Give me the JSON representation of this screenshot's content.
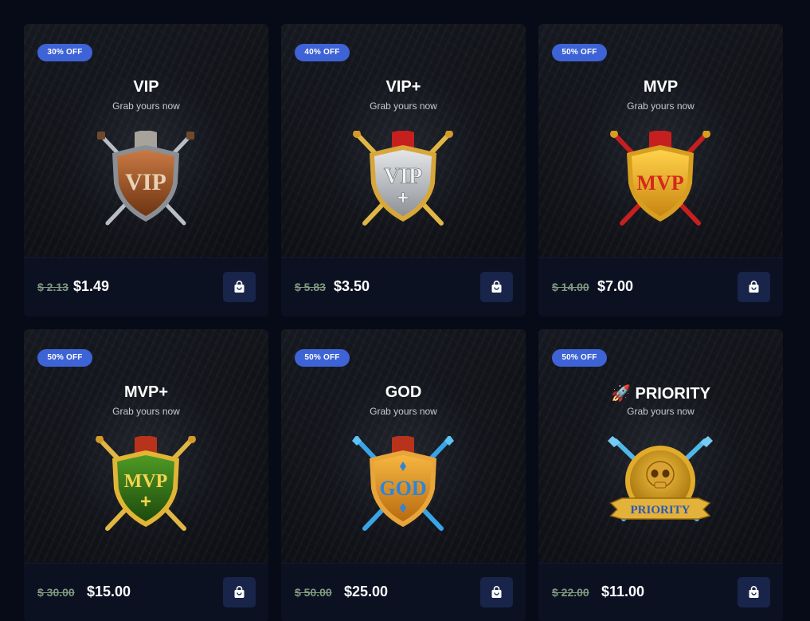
{
  "products": [
    {
      "badge": "30% OFF",
      "title": "VIP",
      "subtitle": "Grab yours now",
      "old_price": "$ 2.13",
      "new_price": "$1.49",
      "emblem_text": "VIP",
      "emblem_icon": "vip-shield-emblem-icon",
      "colors": {
        "shield_light": "#c97a44",
        "shield_dark": "#6e3412",
        "rim": "#8a8f96",
        "ribbon": "#a7a39b",
        "blade": "#b9bec6",
        "letters": "#e7d2b5"
      }
    },
    {
      "badge": "40% OFF",
      "title": "VIP+",
      "subtitle": "Grab yours now",
      "old_price": "$ 5.83",
      "new_price": "$3.50",
      "emblem_text": "VIP",
      "emblem_plus": "+",
      "emblem_icon": "vip-plus-shield-emblem-icon",
      "colors": {
        "shield_light": "#e4e6e8",
        "shield_dark": "#8d9196",
        "rim": "#d7a73a",
        "ribbon": "#c61f1f",
        "blade": "#e0b645",
        "letters": "#f3f3f3"
      }
    },
    {
      "badge": "50% OFF",
      "title": "MVP",
      "subtitle": "Grab yours now",
      "old_price": "$ 14.00",
      "new_price": "$7.00",
      "emblem_text": "MVP",
      "emblem_icon": "mvp-shield-emblem-icon",
      "colors": {
        "shield_light": "#ffd24a",
        "shield_dark": "#c98612",
        "rim": "#d79e20",
        "ribbon": "#c61f1f",
        "blade": "#c71f1f",
        "letters": "#d5281d"
      }
    },
    {
      "badge": "50% OFF",
      "title": "MVP+",
      "subtitle": "Grab yours now",
      "old_price": "$ 30.00",
      "new_price": "$15.00",
      "emblem_text": "MVP",
      "emblem_plus": "+",
      "emblem_icon": "mvp-plus-shield-emblem-icon",
      "colors": {
        "shield_light": "#4f9a24",
        "shield_dark": "#1d4a0d",
        "rim": "#e2b535",
        "ribbon": "#b8331b",
        "blade": "#e0b645",
        "letters": "#f6d34f"
      }
    },
    {
      "badge": "50% OFF",
      "title": "GOD",
      "subtitle": "Grab yours now",
      "old_price": "$ 50.00",
      "new_price": "$25.00",
      "emblem_text": "GOD",
      "emblem_icon": "god-shield-emblem-icon",
      "colors": {
        "shield_light": "#f5b640",
        "shield_dark": "#b96b10",
        "rim": "#e8a63a",
        "ribbon": "#b8331b",
        "blade": "#39a4e6",
        "letters": "#2f84d8"
      }
    },
    {
      "badge": "50% OFF",
      "title": "🚀 PRIORITY",
      "subtitle": "Grab yours now",
      "old_price": "$ 22.00",
      "new_price": "$11.00",
      "emblem_text": "PRIORITY",
      "emblem_icon": "priority-skull-emblem-icon",
      "colors": {
        "shield_light": "#f2c43f",
        "shield_dark": "#a8740f",
        "rim": "#e1ab2c",
        "ribbon": "#e3b23a",
        "blade": "#4fb7ea",
        "letters": "#2d57b8"
      }
    }
  ],
  "cart_button_icon": "shopping-bag-icon"
}
